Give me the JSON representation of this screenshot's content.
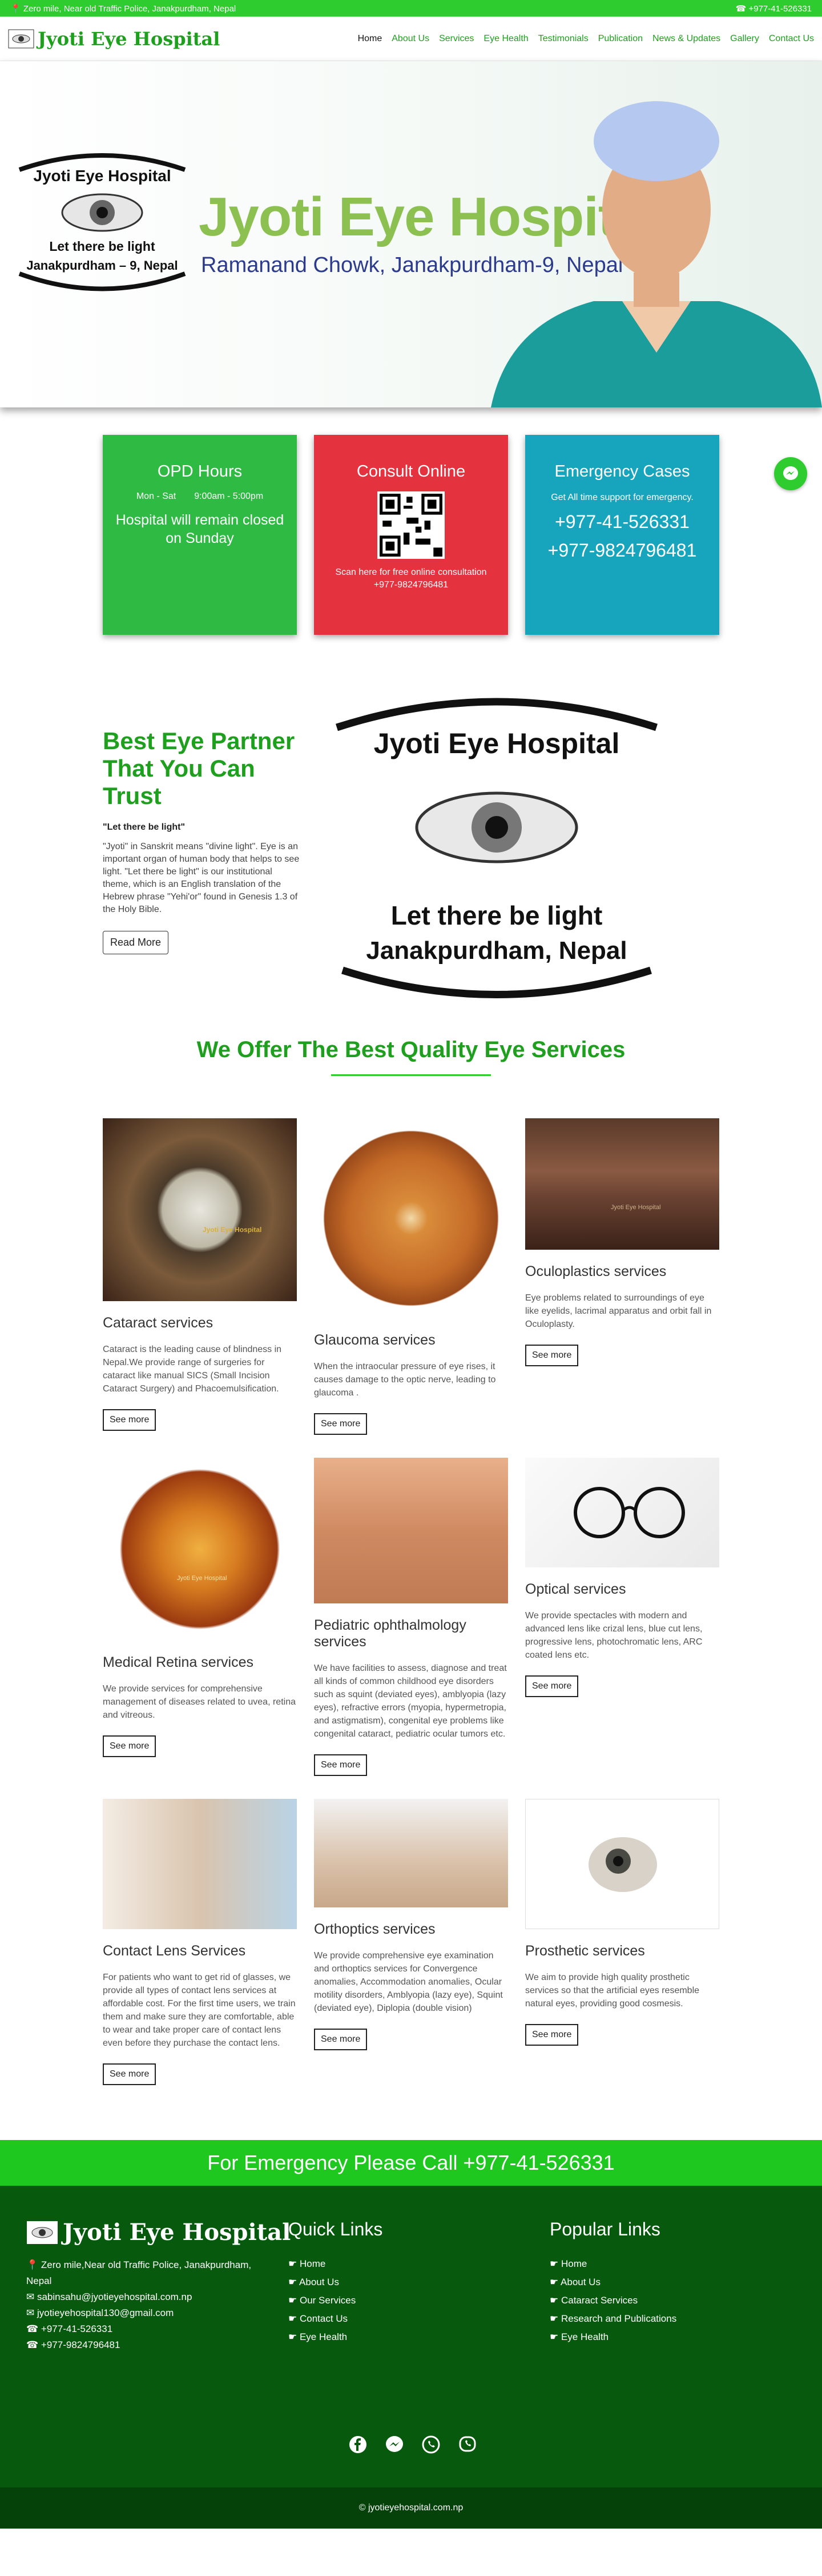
{
  "topbar": {
    "address": "Zero mile, Near old Traffic Police, Janakpurdham, Nepal",
    "phone": "+977-41-526331"
  },
  "brand": {
    "name": "Jyoti Eye Hospital"
  },
  "nav": [
    {
      "label": "Home"
    },
    {
      "label": "About Us"
    },
    {
      "label": "Services"
    },
    {
      "label": "Eye Health"
    },
    {
      "label": "Testimonials"
    },
    {
      "label": "Publication"
    },
    {
      "label": "News & Updates"
    },
    {
      "label": "Gallery"
    },
    {
      "label": "Contact Us"
    }
  ],
  "hero": {
    "logo_top": "Jyoti Eye Hospital",
    "logo_tag": "Let there be light",
    "logo_bottom": "Janakpurdham – 9, Nepal",
    "title": "Jyoti Eye Hospital",
    "subtitle": "Ramanand Chowk, Janakpurdham-9, Nepal"
  },
  "cards": {
    "opd": {
      "title": "OPD Hours",
      "days": "Mon - Sat",
      "time": "9:00am - 5:00pm",
      "note": "Hospital will remain closed on Sunday"
    },
    "consult": {
      "title": "Consult Online",
      "note": "Scan here for free online consultation",
      "phone": "+977-9824796481"
    },
    "emergency": {
      "title": "Emergency Cases",
      "note": "Get All time support for emergency.",
      "phone1": "+977-41-526331",
      "phone2": "+977-9824796481"
    }
  },
  "about": {
    "heading": "Best Eye Partner That You Can Trust",
    "quote": "\"Let there be light\"",
    "body": "\"Jyoti\" in Sanskrit means \"divine light\". Eye is an important organ of human body that helps to see light. \"Let there be light\" is our institutional theme, which is an English translation of the Hebrew phrase \"Yehi'or\" found in Genesis 1.3 of the Holy Bible.",
    "button": "Read More",
    "logo_top": "Jyoti Eye Hospital",
    "logo_tag": "Let there be light",
    "logo_bottom": "Janakpurdham, Nepal"
  },
  "services_title": "We Offer The Best Quality Eye Services",
  "services": [
    {
      "title": "Cataract services",
      "desc": "Cataract is the leading cause of blindness in Nepal.We provide range of surgeries for cataract like manual SICS (Small Incision Cataract Surgery) and Phacoemulsification.",
      "btn": "See more",
      "watermark": "Jyoti Eye Hospital"
    },
    {
      "title": "Glaucoma services",
      "desc": "When the intraocular pressure of eye rises, it causes damage to the optic nerve, leading to glaucoma .",
      "btn": "See more"
    },
    {
      "title": "Oculoplastics services",
      "desc": "Eye problems related to surroundings of eye like eyelids, lacrimal apparatus and orbit fall in Oculoplasty.",
      "btn": "See more",
      "watermark": "Jyoti Eye Hospital"
    },
    {
      "title": "Medical Retina services",
      "desc": "We provide services for comprehensive management of diseases related to uvea, retina and vitreous.",
      "btn": "See more",
      "watermark": "Jyoti Eye Hospital"
    },
    {
      "title": "Pediatric ophthalmology services",
      "desc": "We have facilities to assess, diagnose and treat all kinds of common childhood eye disorders such as squint (deviated eyes), amblyopia (lazy eyes), refractive errors (myopia, hypermetropia, and astigmatism), congenital eye problems like congenital cataract, pediatric ocular tumors etc.",
      "btn": "See more"
    },
    {
      "title": "Optical services",
      "desc": "We provide spectacles with modern and advanced lens like crizal lens, blue cut lens, progressive lens, photochromatic lens, ARC coated lens etc.",
      "btn": "See more"
    },
    {
      "title": "Contact Lens Services",
      "desc": "For patients who want to get rid of glasses, we provide all types of contact lens services at affordable cost. For the first time users, we train them and make sure they are comfortable, able to wear and take proper care of contact lens even before they purchase the contact lens.",
      "btn": "See more"
    },
    {
      "title": "Orthoptics services",
      "desc": "We provide comprehensive eye examination and orthoptics services for Convergence anomalies, Accommodation anomalies, Ocular motility disorders, Amblyopia (lazy eye), Squint (deviated eye), Diplopia (double vision)",
      "btn": "See more"
    },
    {
      "title": "Prosthetic services",
      "desc": "We aim to provide high quality prosthetic services so that the artificial eyes resemble natural eyes, providing good cosmesis.",
      "btn": "See more"
    }
  ],
  "emergency_banner": "For Emergency Please Call +977-41-526331",
  "footer": {
    "brand": "Jyoti Eye Hospital",
    "address": "Zero mile,Near old Traffic Police, Janakpurdham, Nepal",
    "email1": "sabinsahu@jyotieyehospital.com.np",
    "email2": "jyotieyehospital130@gmail.com",
    "phone1": "+977-41-526331",
    "phone2": "+977-9824796481",
    "quick_title": "Quick Links",
    "quick": [
      {
        "label": "Home"
      },
      {
        "label": "About Us"
      },
      {
        "label": "Our Services"
      },
      {
        "label": "Contact Us"
      },
      {
        "label": "Eye Health"
      }
    ],
    "popular_title": "Popular Links",
    "popular": [
      {
        "label": "Home"
      },
      {
        "label": "About Us"
      },
      {
        "label": "Cataract Services"
      },
      {
        "label": "Research and Publications"
      },
      {
        "label": "Eye Health"
      }
    ],
    "copyright": "© jyotieyehospital.com.np"
  }
}
